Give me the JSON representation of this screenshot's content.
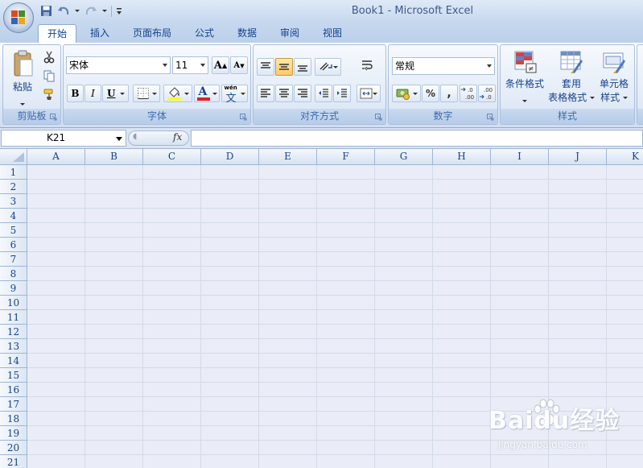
{
  "window": {
    "title": "Book1 - Microsoft Excel"
  },
  "tabs": [
    "开始",
    "插入",
    "页面布局",
    "公式",
    "数据",
    "审阅",
    "视图"
  ],
  "active_tab": "开始",
  "ribbon": {
    "clipboard": {
      "label": "剪贴板",
      "paste_label": "粘贴"
    },
    "font": {
      "label": "字体",
      "font_name": "宋体",
      "font_size": "11",
      "bold": "B",
      "italic": "I",
      "underline": "U",
      "font_color_glyph": "A",
      "grow_glyph": "A",
      "shrink_glyph": "A",
      "phonetic_glyph": "wén",
      "phonetic_char": "文"
    },
    "alignment": {
      "label": "对齐方式"
    },
    "number": {
      "label": "数字",
      "format": "常规",
      "percent": "%",
      "comma": ",",
      "inc_decimal": ".0 .00",
      "dec_decimal": ".00 .0"
    },
    "styles": {
      "label": "样式",
      "conditional_format": "条件格式",
      "format_table_line1": "套用",
      "format_table_line2": "表格格式",
      "cell_styles_line1": "单元格",
      "cell_styles_line2": "样式"
    }
  },
  "formula_bar": {
    "name_box": "K21",
    "fx_label": "fx",
    "formula": ""
  },
  "grid": {
    "columns": [
      "A",
      "B",
      "C",
      "D",
      "E",
      "F",
      "G",
      "H",
      "I",
      "J",
      "K"
    ],
    "rows": [
      "1",
      "2",
      "3",
      "4",
      "5",
      "6",
      "7",
      "8",
      "9",
      "10",
      "11",
      "12",
      "13",
      "14",
      "15",
      "16",
      "17",
      "18",
      "19",
      "20",
      "21"
    ]
  },
  "watermark": {
    "brand": "Baidu经验",
    "url": "jingyan.baidu.com"
  },
  "colors": {
    "ribbon_text": "#15428b",
    "grid_line": "#d3dae8",
    "cell_bg": "#eaedf7",
    "font_color_bar": "#e02020",
    "fill_color_bar": "#ffff00"
  }
}
